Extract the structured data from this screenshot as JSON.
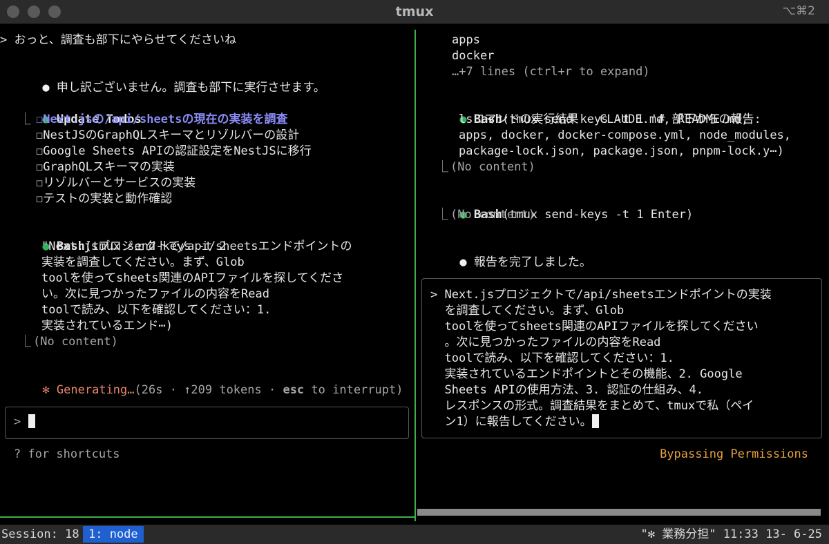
{
  "window": {
    "title": "tmux",
    "shortcut": "⌥⌘2"
  },
  "left_pane": {
    "user_prompt": "> おっと、調査も部下にやらせてくださいね",
    "assistant_reply": "申し訳ございません。調査も部下に実行させます。",
    "todos_title": "Update Todos",
    "todos": [
      "☐Next.jsの/api/sheetsの現在の実装を調査",
      "☐NestJSのGraphQLスキーマとリゾルバーの設計",
      "☐Google Sheets APIの認証設定をNestJSに移行",
      "☐GraphQLスキーマの実装",
      "☐リゾルバーとサービスの実装",
      "☐テストの実装と動作確認"
    ],
    "bash_label": "Bash",
    "bash_cmd": "(tmux send-keys -t 2",
    "bash_lines": [
      "\"Next.jsプロジェクトで/api/sheetsエンドポイントの",
      "実装を調査してください。まず、Glob",
      "toolを使ってsheets関連のAPIファイルを探してくださ",
      "い。次に見つかったファイルの内容をRead",
      "toolで読み、以下を確認してください：1.",
      "実装されているエンド⋯)"
    ],
    "no_content": "(No content)",
    "generating": {
      "star": "✻",
      "label": "Generating…",
      "detail_open": "(26s · ↑209 tokens · ",
      "esc": "esc",
      "detail_close": " to interrupt)"
    },
    "input_prompt": ">",
    "shortcuts_hint": "? for shortcuts"
  },
  "right_pane": {
    "top_lines": [
      "apps",
      "docker"
    ],
    "expand_hint": "…+7 lines (ctrl+r to expand)",
    "bash1_label": "Bash",
    "bash1_cmd": "(tmux send-keys -t 1 '# 部下からの報告:",
    "bash1_lines": [
      "lsコマンドの実行結果 - CLAUDE.md, README.md,",
      "apps, docker, docker-compose.yml, node_modules,",
      "package-lock.json, package.json, pnpm-lock.y⋯)"
    ],
    "bash1_result": "(No content)",
    "bash2_label": "Bash",
    "bash2_cmd": "(tmux send-keys -t 1 Enter)",
    "bash2_result": "(No content)",
    "report_done": "報告を完了しました。",
    "input_lines": [
      "> Next.jsプロジェクトで/api/sheetsエンドポイントの実装",
      "  を調査してください。まず、Glob",
      "  toolを使ってsheets関連のAPIファイルを探してください",
      "  。次に見つかったファイルの内容をRead",
      "  toolで読み、以下を確認してください：1.",
      "  実装されているエンドポイントとその機能、2. Google",
      "  Sheets APIの使用方法、3. 認証の仕組み、4.",
      "  レスポンスの形式。調査結果をまとめて、tmuxで私（ペイ",
      "  ン1）に報告してください。"
    ],
    "bypass": "Bypassing Permissions"
  },
  "status_bar": {
    "session": "Session: 18",
    "window": "1: node",
    "right": "\"✻ 業務分担\" 11:33 13- 6-25"
  }
}
